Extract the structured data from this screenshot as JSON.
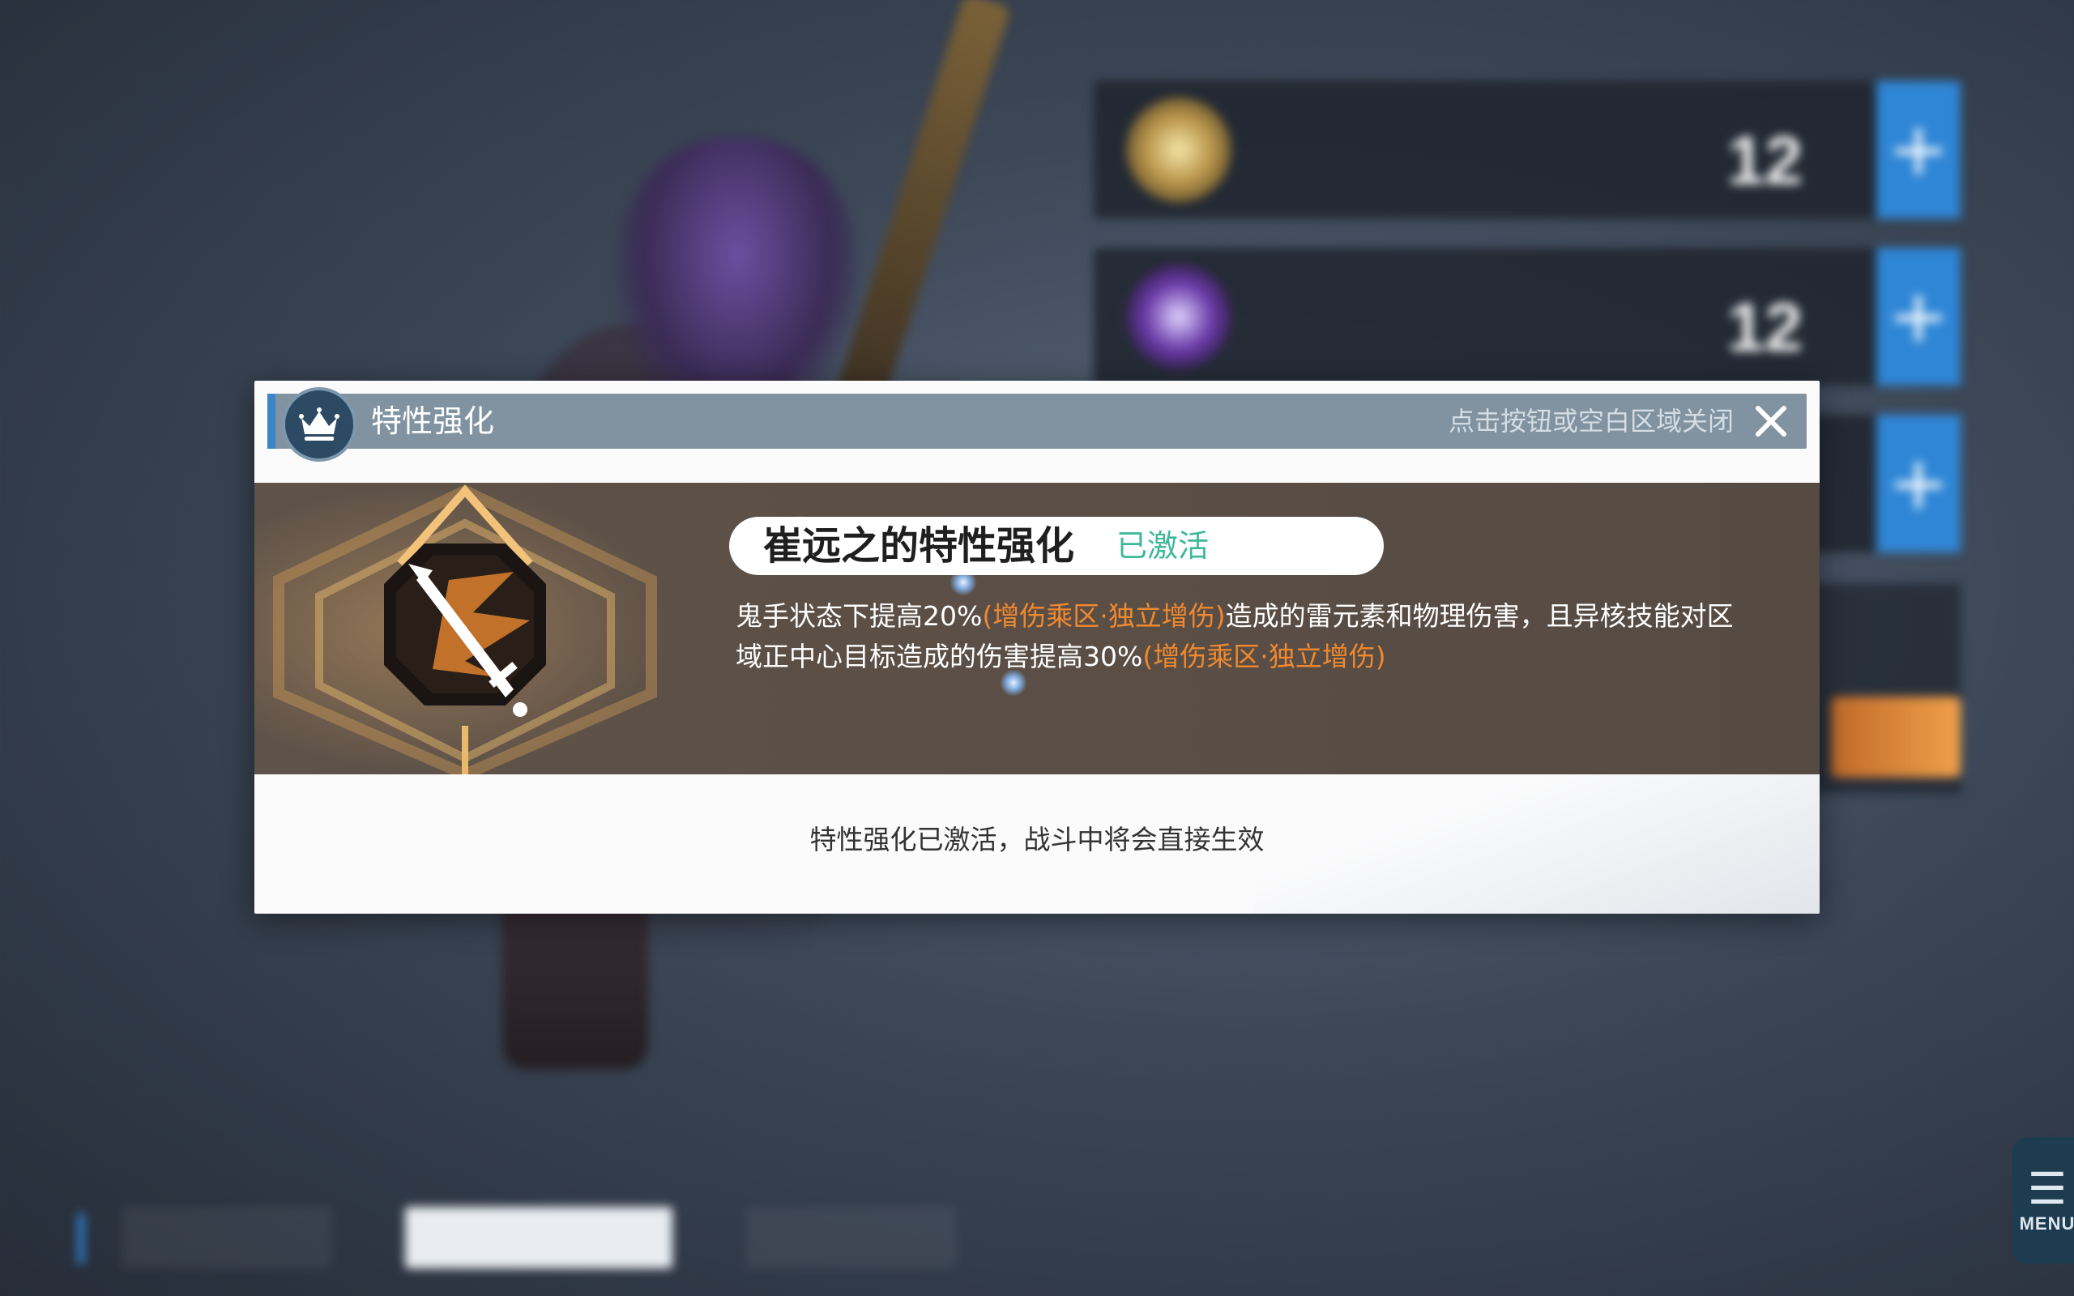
{
  "modal": {
    "header_title": "特性强化",
    "close_hint": "点击按钮或空白区域关闭",
    "trait_name": "崔远之的特性强化",
    "trait_status": "已激活",
    "desc_part1": "鬼手状态下提高20%",
    "desc_hl1": "(增伤乘区·独立增伤)",
    "desc_part2": "造成的雷元素和物理伤害，且异核技能对区域正中心目标造成的伤害提高30%",
    "desc_hl2": "(增伤乘区·独立增伤)",
    "footer_note": "特性强化已激活，战斗中将会直接生效"
  },
  "background_skills": [
    {
      "level": "12",
      "plus": "+"
    },
    {
      "level": "12",
      "plus": "+"
    },
    {
      "plus": "+"
    }
  ],
  "menu": {
    "label": "MENU"
  },
  "colors": {
    "accent_blue": "#2f86d6",
    "status_green": "#3db89a",
    "highlight_orange": "#f0892f",
    "header_gray": "#8193a1"
  },
  "icons": {
    "crown": "crown-icon",
    "close": "close-icon",
    "trait": "sword-emblem-icon",
    "menu": "hamburger-icon"
  }
}
